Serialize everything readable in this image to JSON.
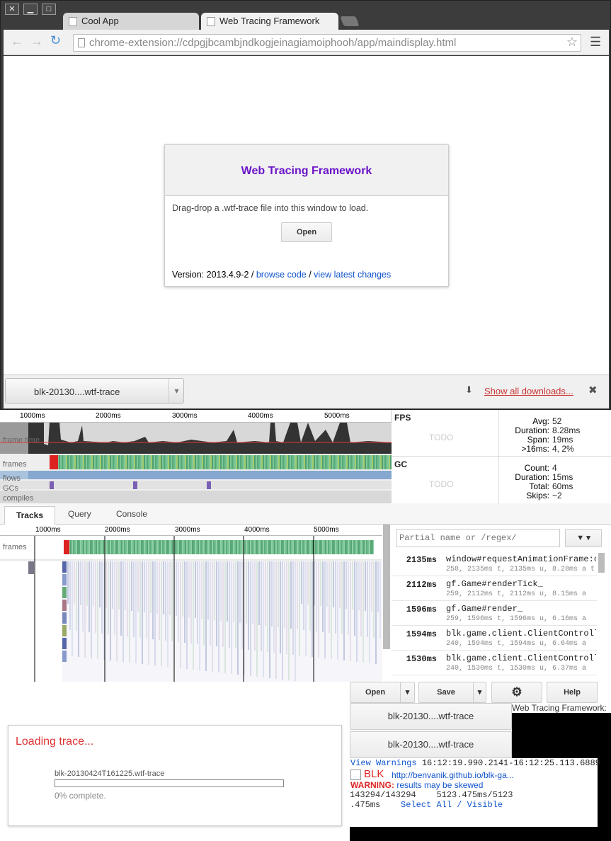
{
  "browser": {
    "tabs": [
      {
        "label": "Cool App"
      },
      {
        "label": "Web Tracing Framework"
      }
    ],
    "url": "chrome-extension://cdpgjbcambjndkogjeinagiamoiphooh/app/maindisplay.html"
  },
  "dialog": {
    "title": "Web Tracing Framework",
    "instructions": "Drag-drop a .wtf-trace file into this window to load.",
    "open_label": "Open",
    "version_label": "Version: 2013.4.9-2 /",
    "browse_code": "browse code",
    "sep": "/",
    "view_changes": "view latest changes"
  },
  "downloads": {
    "item": "blk-20130....wtf-trace",
    "show_all": "Show all downloads..."
  },
  "timeline": {
    "ticks": [
      "1000ms",
      "2000ms",
      "3000ms",
      "4000ms",
      "5000ms"
    ],
    "lanes": {
      "frame_time": "frame time",
      "frames": "frames",
      "flows": "flows",
      "gcs": "GCs",
      "compiles": "compiles"
    }
  },
  "fps": {
    "title": "FPS",
    "todo": "TODO",
    "avg_label": "Avg:",
    "avg": "52",
    "duration_label": "Duration:",
    "duration": "8.28ms",
    "span_label": "Span:",
    "span": "19ms",
    "over_label": ">16ms:",
    "over": "4, 2%"
  },
  "gc": {
    "title": "GC",
    "todo": "TODO",
    "count_label": "Count:",
    "count": "4",
    "duration_label": "Duration:",
    "duration": "15ms",
    "total_label": "Total:",
    "total": "60ms",
    "skips_label": "Skips:",
    "skips": "~2"
  },
  "tabs": [
    {
      "label": "Tracks"
    },
    {
      "label": "Query"
    },
    {
      "label": "Console"
    }
  ],
  "tracks": {
    "frames_label": "frames"
  },
  "search": {
    "placeholder": "Partial name or /regex/"
  },
  "events": [
    {
      "time": "2135ms",
      "name": "window#requestAnimationFrame:c",
      "sub": "258, 2135ms t, 2135ms u, 8.28ms a t"
    },
    {
      "time": "2112ms",
      "name": "gf.Game#renderTick_",
      "sub": "259, 2112ms t, 2112ms u, 8.15ms a"
    },
    {
      "time": "1596ms",
      "name": "gf.Game#render_",
      "sub": "259, 1596ms t, 1596ms u, 6.16ms a"
    },
    {
      "time": "1594ms",
      "name": "blk.game.client.ClientControll",
      "sub": "240, 1594ms t, 1594ms u, 6.64ms a"
    },
    {
      "time": "1530ms",
      "name": "blk.game.client.ClientControll",
      "sub": "240, 1530ms t, 1530ms u, 6.37ms a"
    }
  ],
  "toolbar": {
    "open": "Open",
    "save": "Save",
    "help": "Help",
    "hover_label": "Web Tracing Framework:"
  },
  "file_buttons": [
    "blk-20130....wtf-trace",
    "blk-20130....wtf-trace"
  ],
  "loading": {
    "title": "Loading trace...",
    "file": "blk-20130424T161225.wtf-trace",
    "progress": 0,
    "status": "0% complete."
  },
  "overlay": {
    "view_warnings": "View Warnings",
    "range": "16:12:19.990.2141-16:12:25.113.6889",
    "app_name": "BLK",
    "app_link": "http://benvanik.github.io/blk-ga...",
    "warning_label": "WARNING:",
    "warning_text": "results may be skewed",
    "counts_left": "143294/143294",
    "counts_right": "5123.475ms/5123",
    "ms_left": ".475ms",
    "select_all": "Select All",
    "slash": "/",
    "visible": "Visible"
  }
}
